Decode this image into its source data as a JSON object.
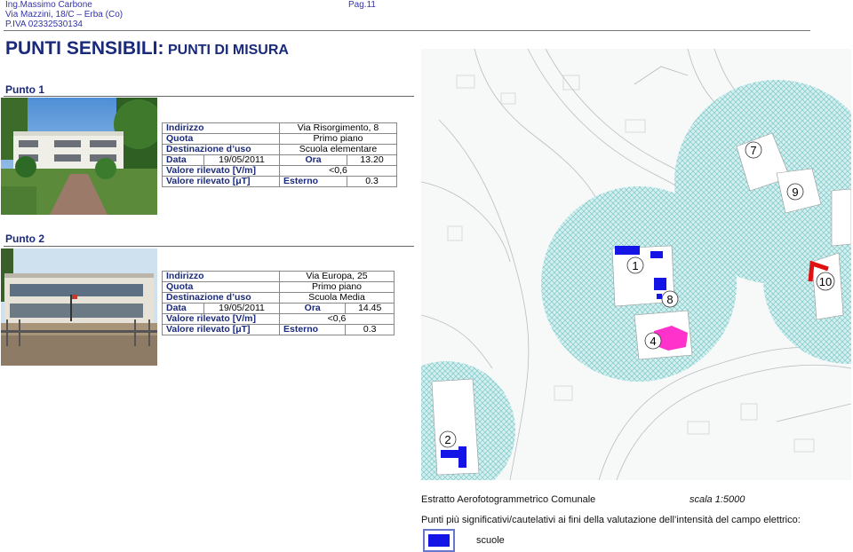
{
  "header": {
    "name": "Ing.Massimo Carbone",
    "address": "Via Mazzini, 18/C – Erba (Co)",
    "piva": "P.IVA 02332530134",
    "page": "Pag.11"
  },
  "title": {
    "main": "PUNTI SENSIBILI:",
    "sub": "PUNTI DI MISURA"
  },
  "points": [
    {
      "heading": "Punto 1",
      "rows": {
        "indirizzo_label": "Indirizzo",
        "indirizzo": "Via Risorgimento, 8",
        "quota_label": "Quota",
        "quota": "Primo piano",
        "dest_label": "Destinazione d’uso",
        "dest": "Scuola elementare",
        "data_label": "Data",
        "data": "19/05/2011",
        "ora_label": "Ora",
        "ora": "13.20",
        "v_label": "Valore rilevato [V/m]",
        "v": "<0,6",
        "ut_label": "Valore rilevato [μT]",
        "ut_where": "Esterno",
        "ut": "0.3"
      }
    },
    {
      "heading": "Punto 2",
      "rows": {
        "indirizzo_label": "Indirizzo",
        "indirizzo": "Via Europa, 25",
        "quota_label": "Quota",
        "quota": "Primo piano",
        "dest_label": "Destinazione d’uso",
        "dest": "Scuola Media",
        "data_label": "Data",
        "data": "19/05/2011",
        "ora_label": "Ora",
        "ora": "14.45",
        "v_label": "Valore rilevato [V/m]",
        "v": "<0,6",
        "ut_label": "Valore rilevato [μT]",
        "ut_where": "Esterno",
        "ut": "0.3"
      }
    }
  ],
  "map": {
    "markers": [
      "7",
      "9",
      "1",
      "8",
      "10",
      "4",
      "2"
    ],
    "colors": {
      "zone": "#8fd6d6",
      "school": "#1414e6",
      "highlight": "#ff33cc",
      "antenna": "#e01010"
    }
  },
  "caption": {
    "source": "Estratto Aerofotogrammetrico Comunale",
    "scale": "scala 1:5000",
    "note": "Punti più significativi/cautelativi ai fini della valutazione dell’intensità del campo elettrico:",
    "legend_label": "scuole"
  }
}
